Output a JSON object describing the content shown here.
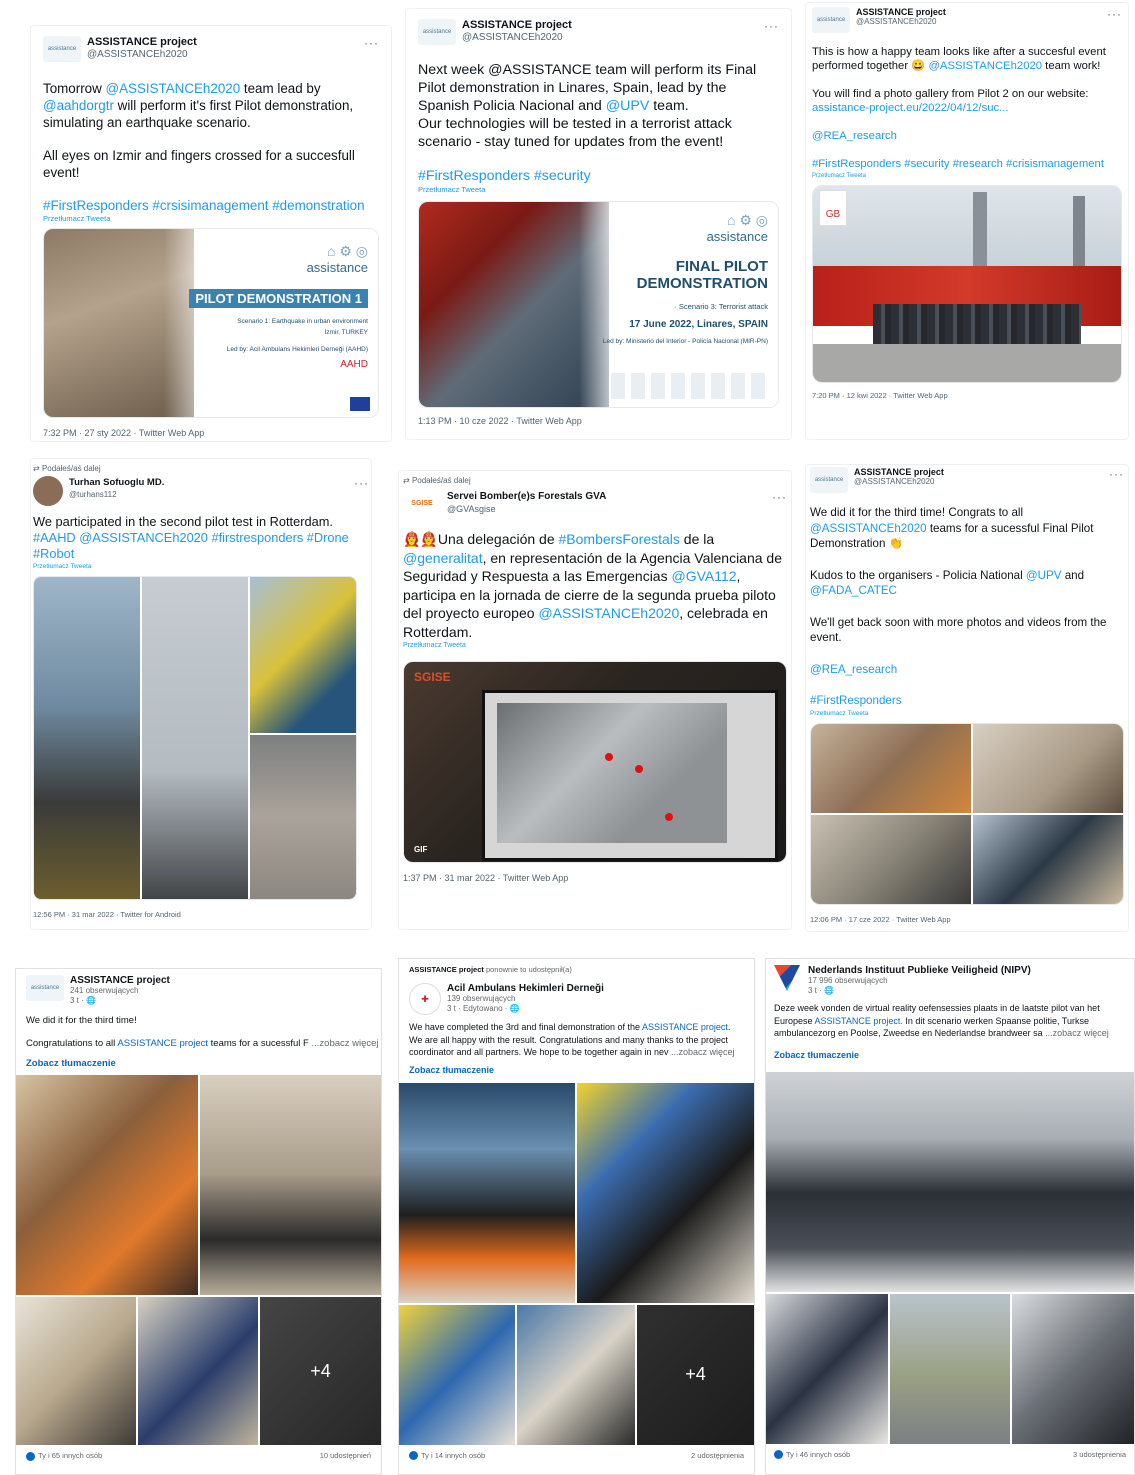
{
  "t1": {
    "name": "ASSISTANCE project",
    "handle": "@ASSISTANCEh2020",
    "logo_text": "assistance",
    "text1": "Tomorrow ",
    "mention1": "@ASSISTANCEh2020",
    "text2": " team lead by ",
    "mention2": "@aahdorgtr",
    "text3": " will perform it's first Pilot demonstration, simulating an earthquake scenario.",
    "text4": "All eyes on Izmir and fingers crossed for a succesfull event!",
    "hashtags": "#FirstResponders #crsisimanagement #demonstration",
    "translate": "Przetłumacz Tweeta",
    "poster": {
      "brand": "assistance",
      "title": "PILOT DEMONSTRATION 1",
      "line1": "Scenario 1: Earthquake in urban environment",
      "line2": "Izmir, TURKEY",
      "line3": "Led by: Acil Ambulans Hekimleri Derneği (AAHD)",
      "aahd": "AAHD"
    },
    "meta": "7:32 PM · 27 sty 2022 · Twitter Web App"
  },
  "t2": {
    "name": "ASSISTANCE project",
    "handle": "@ASSISTANCEh2020",
    "logo_text": "assistance",
    "text1": "Next week @ASSISTANCE team will perform its Final Pilot demonstration in Linares, Spain, lead by the Spanish Policia Nacional and ",
    "mention1": "@UPV",
    "text2": " team.\nOur technologies will be tested in a terrorist attack scenario - stay tuned for updates from the event!",
    "hashtags": "#FirstResponders #security",
    "translate": "Przetłumacz Tweeta",
    "poster": {
      "brand": "assistance",
      "title1": "FINAL PILOT",
      "title2": "DEMONSTRATION",
      "line1": "· Scenario 3: Terrorist attack",
      "line2": "17 June 2022, Linares, SPAIN",
      "line3": "Led by: Ministerio del Interior - Policía Nacional (MIR-PN)"
    },
    "meta": "1:13 PM · 10 cze 2022 · Twitter Web App"
  },
  "t3": {
    "name": "ASSISTANCE project",
    "handle": "@ASSISTANCEh2020",
    "logo_text": "assistance",
    "text1": "This is how a happy team looks like after a succesful event performed together 😀 ",
    "mention1": "@ASSISTANCEh2020",
    "text2": " team work!",
    "text3": "You will find a photo gallery from Pilot 2 on our website: ",
    "link": "assistance-project.eu/2022/04/12/suc...",
    "mention2": "@REA_research",
    "hashtags": "#FirstResponders #security #research #crisismanagement",
    "translate": "Przetłumacz Tweeta",
    "meta": "7:20 PM · 12 kwi 2022 · Twitter Web App"
  },
  "t4": {
    "retweet": "Podałeś/aś dalej",
    "name": "Turhan Sofuoglu MD.",
    "handle": "@turhans112",
    "text1": "We participated in the second pilot test in Rotterdam. ",
    "hashtags": "#AAHD @ASSISTANCEh2020 #firstresponders #Drone #Robot",
    "translate": "Przetłumacz Tweeta",
    "meta": "12:56 PM · 31 mar 2022 · Twitter for Android"
  },
  "t5": {
    "retweet": "Podałeś/aś dalej",
    "name": "Servei Bomber(e)s Forestals GVA",
    "handle": "@GVAsgise",
    "logo_text": "SGISE",
    "text1": "👩‍🚒👨‍🚒Una delegación de ",
    "mention1": "#BombersForestals",
    "text2": " de la ",
    "mention2": "@generalitat",
    "text3": ", en representación de la Agencia Valenciana de Seguridad y Respuesta a las Emergencias ",
    "mention3": "@GVA112",
    "text4": ", participa en la jornada de cierre de la segunda prueba piloto del proyecto europeo ",
    "mention4": "@ASSISTANCEh2020",
    "text5": ", celebrada en Rotterdam.",
    "translate": "Przetłumacz Tweeta",
    "gif": "GIF",
    "watermark": "SGISE",
    "meta": "1:37 PM · 31 mar 2022 · Twitter Web App"
  },
  "t6": {
    "name": "ASSISTANCE project",
    "handle": "@ASSISTANCEh2020",
    "logo_text": "assistance",
    "text1": "We did it for the third time! Congrats to all ",
    "mention1": "@ASSISTANCEh2020",
    "text2": " teams for a sucessful Final Pilot Demonstration 👏",
    "text3": "Kudos to the organisers - Policia National ",
    "mention2": "@UPV",
    "text4": " and ",
    "mention3": "@FADA_CATEC",
    "text5": "We'll get back soon with more photos and videos from the event.",
    "mention4": "@REA_research",
    "hashtags": "#FirstResponders",
    "translate": "Przetłumacz Tweeta",
    "meta": "12:06 PM · 17 cze 2022 · Twitter Web App"
  },
  "f1": {
    "name": "ASSISTANCE project",
    "logo_text": "assistance",
    "followers": "241 obserwujących",
    "time": "3 t · 🌐",
    "text1": "We did it for the third time!",
    "text2": "Congratulations to all ",
    "link": "ASSISTANCE project",
    "text3": " teams for a sucessful F",
    "more": " ...zobacz więcej",
    "see_translation": "Zobacz tłumaczenie",
    "plus": "+4",
    "reactions": "Ty i 65 innych osób",
    "shares": "10 udostępnień"
  },
  "f2": {
    "shared_by": "ASSISTANCE project",
    "shared_text": " ponownie to udostępnił(a)",
    "name": "Acil Ambulans Hekimleri Derneği",
    "followers": "139 obserwujących",
    "time": "3 t · Edytowano · 🌐",
    "text1": "We have completed the 3rd and final demonstration of the ",
    "link": "ASSISTANCE project",
    "text2": ". We are all happy with the result. Congratulations and many thanks to the project coordinator and all partners. We hope to be together again in nev",
    "more": " ...zobacz więcej",
    "see_translation": "Zobacz tłumaczenie",
    "plus": "+4",
    "reactions": "Ty i 14 innych osób",
    "shares": "2 udostępnienia"
  },
  "f3": {
    "name": "Nederlands Instituut Publieke Veiligheid (NIPV)",
    "followers": "17 996 obserwujących",
    "time": "3 t · 🌐",
    "text1": "Deze week vonden de virtual reality oefensessies plaats in de laatste pilot van het Europese ",
    "link": "ASSISTANCE project.",
    "text2": " In dit scenario werken Spaanse politie, Turkse ambulancezorg en Poolse, Zweedse en Nederlandse brandweer sa",
    "more": " ...zobacz więcej",
    "see_translation": "Zobacz tłumaczenie",
    "reactions": "Ty i 46 innych osób",
    "shares": "3 udostępnienia"
  },
  "colors": {
    "twitter_blue": "#1d9bf0",
    "linkedin_blue": "#0a66c2",
    "text": "#0f1419",
    "muted": "#536471"
  }
}
